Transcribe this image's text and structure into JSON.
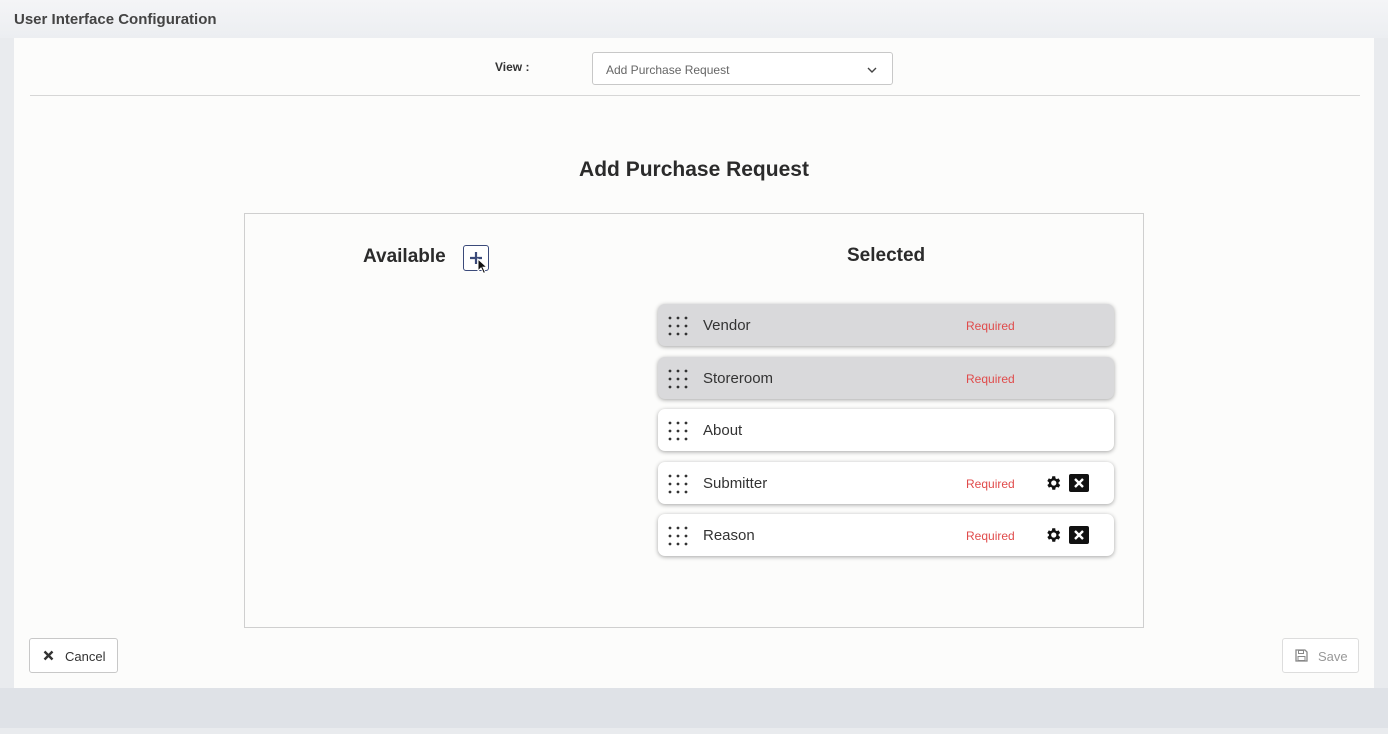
{
  "page": {
    "title": "User Interface Configuration"
  },
  "view": {
    "label": "View :",
    "selected": "Add Purchase Request"
  },
  "section": {
    "title": "Add Purchase Request"
  },
  "available": {
    "title": "Available",
    "add_icon": "plus-icon"
  },
  "selected": {
    "title": "Selected",
    "fields": [
      {
        "label": "Vendor",
        "required": "Required",
        "locked": true
      },
      {
        "label": "Storeroom",
        "required": "Required",
        "locked": true
      },
      {
        "label": "About",
        "required": "",
        "locked": false
      },
      {
        "label": "Submitter",
        "required": "Required",
        "locked": false
      },
      {
        "label": "Reason",
        "required": "Required",
        "locked": false
      }
    ]
  },
  "actions": {
    "cancel_label": "Cancel",
    "save_label": "Save"
  },
  "colors": {
    "required": "#e04b4b",
    "accent": "#3b4a7a",
    "locked_row": "#d9d9db"
  }
}
